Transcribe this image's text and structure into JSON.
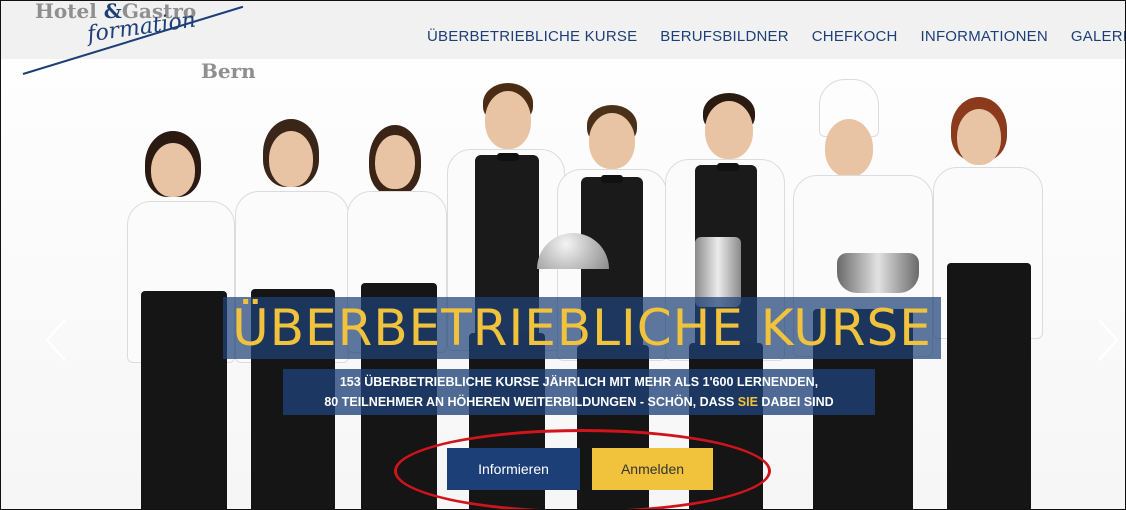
{
  "header": {
    "logo": {
      "top_text": "Hotel",
      "amp": "&",
      "gastro": "Gastro",
      "script_text": "formation",
      "city": "Bern"
    },
    "nav": [
      {
        "label": "ÜBERBETRIEBLICHE KURSE"
      },
      {
        "label": "BERUFSBILDNER"
      },
      {
        "label": "CHEFKOCH"
      },
      {
        "label": "INFORMATIONEN"
      },
      {
        "label": "GALERIEN"
      }
    ]
  },
  "hero": {
    "headline": "ÜBERBETRIEBLICHE KURSE",
    "sub_line1": "153 ÜBERBETRIEBLICHE KURSE JÄHRLICH MIT MEHR ALS 1'600 LERNENDEN,",
    "sub_line2_before": "80 TEILNEHMER AN HÖHEREN WEITERBILDUNGEN - SCHÖN, DASS ",
    "sub_line2_highlight": "SIE",
    "sub_line2_after": " DABEI SIND",
    "buttons": {
      "info": "Informieren",
      "register": "Anmelden"
    },
    "arrows": {
      "prev": "chevron-left-icon",
      "next": "chevron-right-icon"
    }
  },
  "colors": {
    "brand_blue": "#1d3f78",
    "accent_yellow": "#f1c33c",
    "annotation_red": "#d0141c"
  }
}
